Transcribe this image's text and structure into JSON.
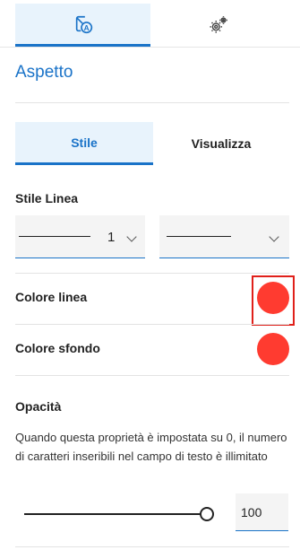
{
  "top_tabs": [
    {
      "icon": "style-text-icon",
      "active": true
    },
    {
      "icon": "gears-icon",
      "active": false
    }
  ],
  "section_title": "Aspetto",
  "sub_tabs": [
    {
      "label": "Stile",
      "active": true
    },
    {
      "label": "Visualizza",
      "active": false
    }
  ],
  "line_style": {
    "label": "Stile Linea",
    "width_value": "1",
    "dash_value": "solid"
  },
  "line_color": {
    "label": "Colore linea",
    "color": "#ff3b30"
  },
  "background_color": {
    "label": "Colore sfondo",
    "color": "#ff3b30"
  },
  "opacity": {
    "label": "Opacità",
    "description": "Quando questa proprietà è impostata su 0, il numero di caratteri inseribili nel campo di testo è illimitato",
    "value": "100",
    "fraction": 1.0
  },
  "colors": {
    "accent": "#1a73c8",
    "active_tab_bg": "#e8f3fc",
    "highlight_border": "#e0201a"
  }
}
